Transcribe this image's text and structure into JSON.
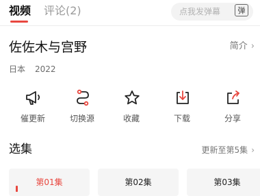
{
  "tabs": [
    {
      "label": "视频",
      "active": true
    },
    {
      "label": "评论(2)",
      "active": false
    }
  ],
  "danmaku": {
    "placeholder": "点我发弹幕",
    "toggle_label": "弹"
  },
  "show": {
    "title": "佐佐木与宫野",
    "intro_label": "简介",
    "region": "日本",
    "year": "2022"
  },
  "actions": [
    {
      "label": "催更新",
      "icon": "megaphone-icon"
    },
    {
      "label": "切换源",
      "icon": "switch-source-icon"
    },
    {
      "label": "收藏",
      "icon": "star-icon"
    },
    {
      "label": "下载",
      "icon": "download-icon"
    },
    {
      "label": "分享",
      "icon": "share-icon"
    }
  ],
  "episodes_section": {
    "title": "选集",
    "update_info": "更新至第5集"
  },
  "episodes": [
    {
      "label": "第01集",
      "current": true
    },
    {
      "label": "第02集",
      "current": false
    },
    {
      "label": "第03集",
      "current": false
    }
  ],
  "colors": {
    "accent": "#e8473f",
    "muted_text": "#9a9a9a",
    "chip_background": "#f5f5f5"
  }
}
